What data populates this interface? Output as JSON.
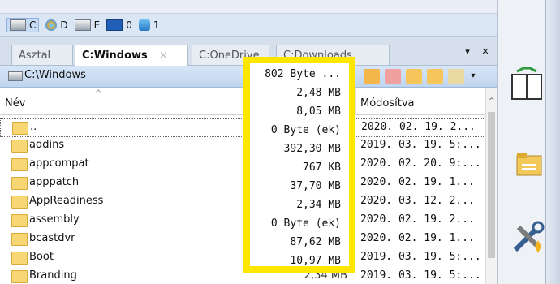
{
  "drives": [
    {
      "letter": "C",
      "icon": "hdd-icon",
      "active": true
    },
    {
      "letter": "D",
      "icon": "dvd-icon",
      "active": false
    },
    {
      "letter": "E",
      "icon": "hdd-icon",
      "active": false
    },
    {
      "letter": "0",
      "icon": "usb-icon",
      "active": false
    },
    {
      "letter": "1",
      "icon": "network-drive-icon",
      "active": false
    }
  ],
  "tabs": [
    "Asztal",
    "C:Windows",
    "C:OneDrive",
    "C:Downloads"
  ],
  "tab_close": "×",
  "tab_dropdown": "▾",
  "tab_close_panel": "✕",
  "path": "C:\\Windows",
  "columns": {
    "name": "Név",
    "sort_indicator": "^",
    "modified": "Módosítva"
  },
  "rows": [
    {
      "name": "..",
      "size": "802 Byte ...",
      "date": "2020. 02. 19. 2..."
    },
    {
      "name": "addins",
      "size": "2,48 MB",
      "date": "2019. 03. 19. 5:..."
    },
    {
      "name": "appcompat",
      "size": "8,05 MB",
      "date": "2020. 02. 20. 9:..."
    },
    {
      "name": "apppatch",
      "size": "0 Byte (ek)",
      "date": "2020. 02. 19. 1..."
    },
    {
      "name": "AppReadiness",
      "size": "392,30 MB",
      "date": "2020. 03. 12. 2..."
    },
    {
      "name": "assembly",
      "size": "767 KB",
      "date": "2020. 02. 19. 2..."
    },
    {
      "name": "bcastdvr",
      "size": "37,70 MB",
      "date": "2020. 02. 19. 1..."
    },
    {
      "name": "Boot",
      "size": "2,34 MB",
      "date": "2019. 03. 19. 5:..."
    },
    {
      "name": "Branding",
      "size": "0 Byte (ek)",
      "date": "2019. 03. 19. 5:..."
    }
  ],
  "popup_sizes": [
    "802 Byte ...",
    "2,48 MB",
    "8,05 MB",
    "0 Byte (ek)",
    "392,30 MB",
    "767 KB",
    "37,70 MB",
    "2,34 MB",
    "0 Byte (ek)",
    "87,62 MB",
    "10,97 MB"
  ],
  "branding_size_visible": "2,34 MB",
  "colors": {
    "highlight": "#ffe600",
    "folder": "#f7d774",
    "path_bar": "#c7dbf4"
  }
}
